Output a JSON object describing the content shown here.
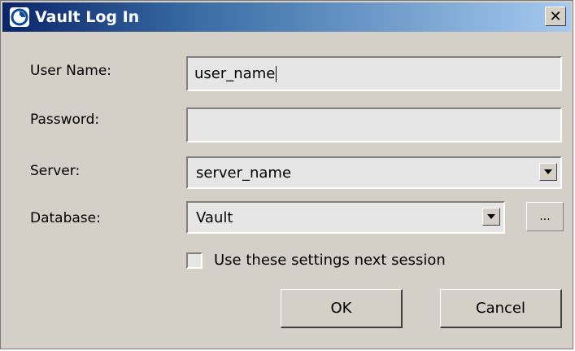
{
  "window": {
    "title": "Vault Log In",
    "close_glyph": "✕",
    "app_icon": "vault-swirl-icon"
  },
  "form": {
    "user_name": {
      "label": "User Name:",
      "value": "user_name"
    },
    "password": {
      "label": "Password:",
      "value": ""
    },
    "server": {
      "label": "Server:",
      "value": "server_name"
    },
    "database": {
      "label": "Database:",
      "value": "Vault",
      "browse_label": "..."
    },
    "remember": {
      "label": "Use these settings next session",
      "checked": false
    }
  },
  "buttons": {
    "ok": "OK",
    "cancel": "Cancel"
  },
  "colors": {
    "title_gradient_start": "#0a246a",
    "title_gradient_end": "#a6caf0",
    "dialog_bg": "#d4d0c8"
  }
}
